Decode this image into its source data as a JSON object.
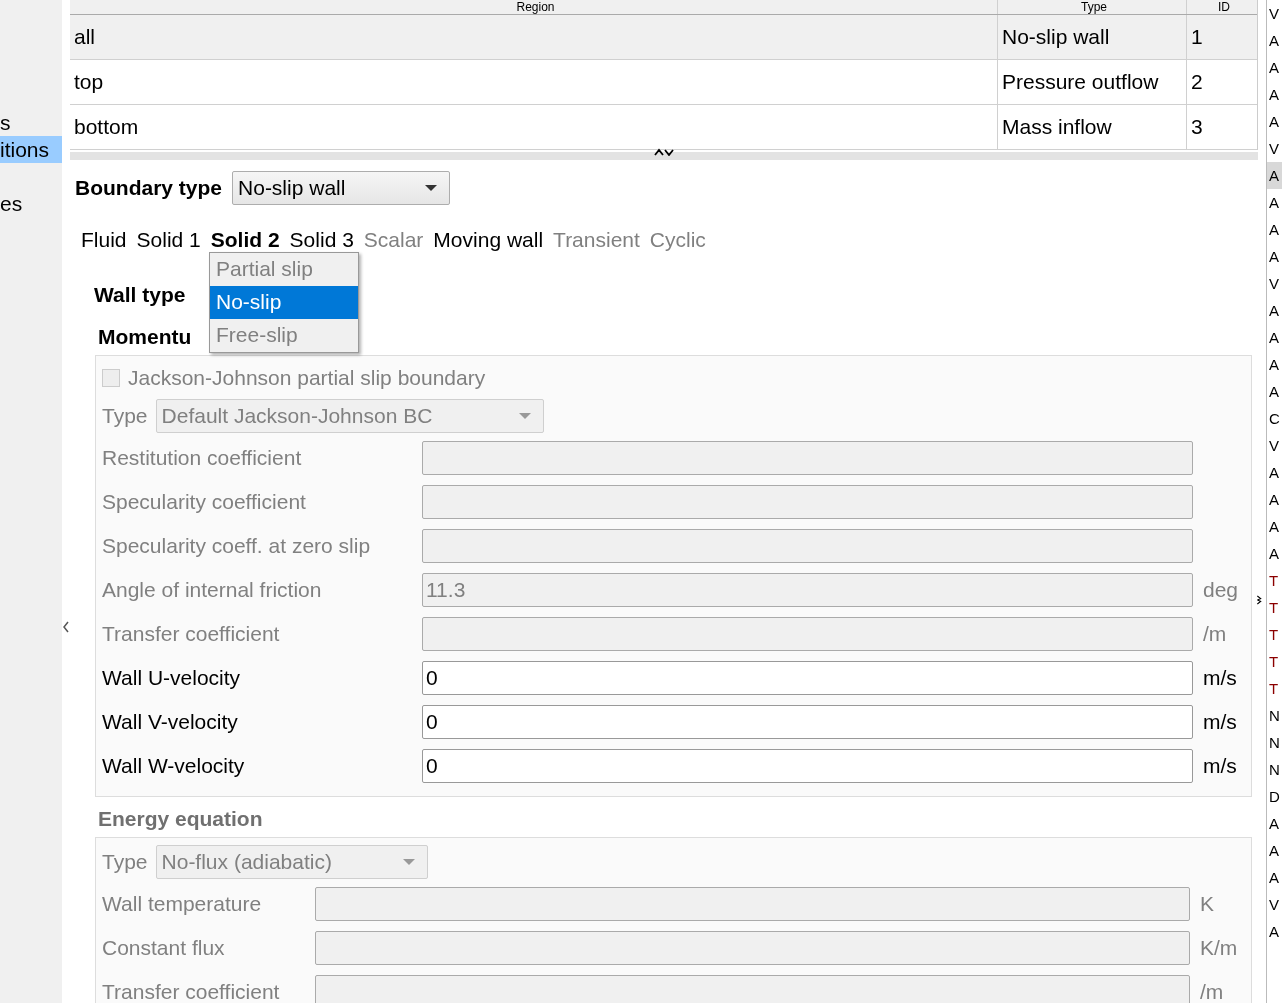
{
  "sidebar": {
    "items": [
      {
        "label": "s",
        "selected": false
      },
      {
        "label": "itions",
        "selected": true
      },
      {
        "label": "es",
        "selected": false
      }
    ]
  },
  "regions_table": {
    "columns": [
      "Region",
      "Type",
      "ID"
    ],
    "rows": [
      {
        "cells": [
          "all",
          "No-slip wall",
          "1"
        ],
        "selected": true
      },
      {
        "cells": [
          "top",
          "Pressure outflow",
          "2"
        ],
        "selected": false
      },
      {
        "cells": [
          "bottom",
          "Mass inflow",
          "3"
        ],
        "selected": false
      }
    ]
  },
  "boundary_type": {
    "label": "Boundary type",
    "value": "No-slip wall"
  },
  "tabs": [
    {
      "label": "Fluid",
      "selected": false,
      "disabled": false
    },
    {
      "label": "Solid 1",
      "selected": false,
      "disabled": false
    },
    {
      "label": "Solid 2",
      "selected": true,
      "disabled": false
    },
    {
      "label": "Solid 3",
      "selected": false,
      "disabled": false
    },
    {
      "label": "Scalar",
      "selected": false,
      "disabled": true
    },
    {
      "label": "Moving wall",
      "selected": false,
      "disabled": false
    },
    {
      "label": "Transient",
      "selected": false,
      "disabled": true
    },
    {
      "label": "Cyclic",
      "selected": false,
      "disabled": true
    }
  ],
  "wall_type": {
    "label": "Wall type",
    "options": [
      {
        "label": "Partial slip",
        "selected": false,
        "disabled": true
      },
      {
        "label": "No-slip",
        "selected": true,
        "disabled": false
      },
      {
        "label": "Free-slip",
        "selected": false,
        "disabled": true
      }
    ]
  },
  "momentum": {
    "title": "Momentu",
    "disabled": false,
    "checkbox": {
      "label": "Jackson-Johnson partial slip boundary",
      "checked": false,
      "disabled": true
    },
    "type": {
      "label": "Type",
      "value": "Default Jackson-Johnson BC",
      "disabled": true
    },
    "fields": [
      {
        "label": "Restitution coefficient",
        "disabled": true
      },
      {
        "label": "Specularity coefficient",
        "disabled": true
      },
      {
        "label": "Specularity coeff. at zero slip",
        "disabled": true
      },
      {
        "label": "Angle of internal friction",
        "value": "11.3",
        "unit": "deg",
        "disabled": true
      },
      {
        "label": "Transfer coefficient",
        "unit": "/m",
        "disabled": true
      },
      {
        "label": "Wall U-velocity",
        "value": "0",
        "unit": "m/s",
        "disabled": false
      },
      {
        "label": "Wall V-velocity",
        "value": "0",
        "unit": "m/s",
        "disabled": false
      },
      {
        "label": "Wall W-velocity",
        "value": "0",
        "unit": "m/s",
        "disabled": false
      }
    ]
  },
  "energy": {
    "title": "Energy equation",
    "disabled": true,
    "type": {
      "label": "Type",
      "value": "No-flux (adiabatic)",
      "disabled": true
    },
    "fields": [
      {
        "label": "Wall temperature",
        "unit": "K",
        "disabled": true
      },
      {
        "label": "Constant flux",
        "unit": "K/m",
        "disabled": true
      },
      {
        "label": "Transfer coefficient",
        "unit": "/m",
        "disabled": true
      }
    ]
  },
  "side_list": {
    "items": [
      {
        "label": "V",
        "selected": false,
        "color": "#000000"
      },
      {
        "label": "A",
        "selected": false,
        "color": "#000000"
      },
      {
        "label": "A",
        "selected": false,
        "color": "#000000"
      },
      {
        "label": "A",
        "selected": false,
        "color": "#000000"
      },
      {
        "label": "A",
        "selected": false,
        "color": "#000000"
      },
      {
        "label": "V",
        "selected": false,
        "color": "#000000"
      },
      {
        "label": "A",
        "selected": true,
        "color": "#000000"
      },
      {
        "label": "A",
        "selected": false,
        "color": "#000000"
      },
      {
        "label": "A",
        "selected": false,
        "color": "#000000"
      },
      {
        "label": "A",
        "selected": false,
        "color": "#000000"
      },
      {
        "label": "V",
        "selected": false,
        "color": "#000000"
      },
      {
        "label": "A",
        "selected": false,
        "color": "#000000"
      },
      {
        "label": "A",
        "selected": false,
        "color": "#000000"
      },
      {
        "label": "A",
        "selected": false,
        "color": "#000000"
      },
      {
        "label": "A",
        "selected": false,
        "color": "#000000"
      },
      {
        "label": "C",
        "selected": false,
        "color": "#000000"
      },
      {
        "label": "V",
        "selected": false,
        "color": "#000000"
      },
      {
        "label": "A",
        "selected": false,
        "color": "#000000"
      },
      {
        "label": "A",
        "selected": false,
        "color": "#000000"
      },
      {
        "label": "A",
        "selected": false,
        "color": "#000000"
      },
      {
        "label": "A",
        "selected": false,
        "color": "#000000"
      },
      {
        "label": "T",
        "selected": false,
        "color": "#8b0000"
      },
      {
        "label": "T",
        "selected": false,
        "color": "#8b0000"
      },
      {
        "label": "T",
        "selected": false,
        "color": "#8b0000"
      },
      {
        "label": "T",
        "selected": false,
        "color": "#8b0000"
      },
      {
        "label": "T",
        "selected": false,
        "color": "#8b0000"
      },
      {
        "label": "N",
        "selected": false,
        "color": "#000000"
      },
      {
        "label": "N",
        "selected": false,
        "color": "#000000"
      },
      {
        "label": "N",
        "selected": false,
        "color": "#000000"
      },
      {
        "label": "D",
        "selected": false,
        "color": "#000000"
      },
      {
        "label": "A",
        "selected": false,
        "color": "#000000"
      },
      {
        "label": "A",
        "selected": false,
        "color": "#000000"
      },
      {
        "label": "A",
        "selected": false,
        "color": "#000000"
      },
      {
        "label": "V",
        "selected": false,
        "color": "#000000"
      },
      {
        "label": "A",
        "selected": false,
        "color": "#000000"
      }
    ]
  }
}
